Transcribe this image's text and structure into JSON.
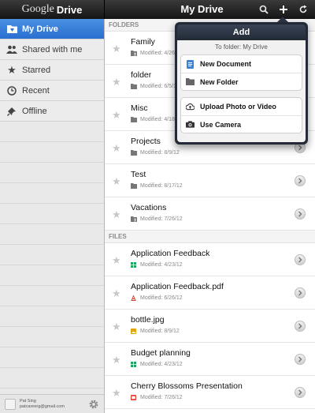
{
  "app": {
    "brand_google": "Google",
    "brand_drive": "Drive"
  },
  "header": {
    "title": "My Drive"
  },
  "sidebar": {
    "items": [
      {
        "label": "My Drive",
        "icon": "folder-icon",
        "active": true
      },
      {
        "label": "Shared with me",
        "icon": "people-icon"
      },
      {
        "label": "Starred",
        "icon": "star-icon"
      },
      {
        "label": "Recent",
        "icon": "clock-icon"
      },
      {
        "label": "Offline",
        "icon": "pin-icon"
      }
    ],
    "user": {
      "name": "Pat Sing",
      "email": "patcareerg@gmail.com"
    }
  },
  "folders_header": "FOLDERS",
  "files_header": "FILES",
  "folders": [
    {
      "name": "Family",
      "modified": "Modified: 4/26/12",
      "icon": "shared-folder-icon"
    },
    {
      "name": "folder",
      "modified": "Modified: 6/5/12",
      "icon": "folder-icon"
    },
    {
      "name": "Misc",
      "modified": "Modified: 4/18/12",
      "icon": "folder-icon"
    },
    {
      "name": "Projects",
      "modified": "Modified: 8/9/12",
      "icon": "folder-icon"
    },
    {
      "name": "Test",
      "modified": "Modified: 8/17/12",
      "icon": "folder-icon"
    },
    {
      "name": "Vacations",
      "modified": "Modified: 7/26/12",
      "icon": "shared-folder-icon"
    }
  ],
  "files": [
    {
      "name": "Application Feedback",
      "modified": "Modified: 4/23/12",
      "icon": "spreadsheet-icon"
    },
    {
      "name": "Application Feedback.pdf",
      "modified": "Modified: 6/26/12",
      "icon": "pdf-icon"
    },
    {
      "name": "bottle.jpg",
      "modified": "Modified: 8/9/12",
      "icon": "image-icon"
    },
    {
      "name": "Budget planning",
      "modified": "Modified: 4/23/12",
      "icon": "spreadsheet-icon"
    },
    {
      "name": "Cherry Blossoms Presentation",
      "modified": "Modified: 7/26/12",
      "icon": "presentation-icon"
    }
  ],
  "popover": {
    "title": "Add",
    "subtitle": "To folder:  My Drive",
    "new_document": "New Document",
    "new_folder": "New Folder",
    "upload": "Upload Photo or Video",
    "camera": "Use Camera"
  },
  "colors": {
    "accent": "#2a6fd0",
    "spreadsheet": "#1fa463",
    "pdf": "#d23b2c",
    "image": "#e0a500",
    "presentation": "#e2463a"
  }
}
